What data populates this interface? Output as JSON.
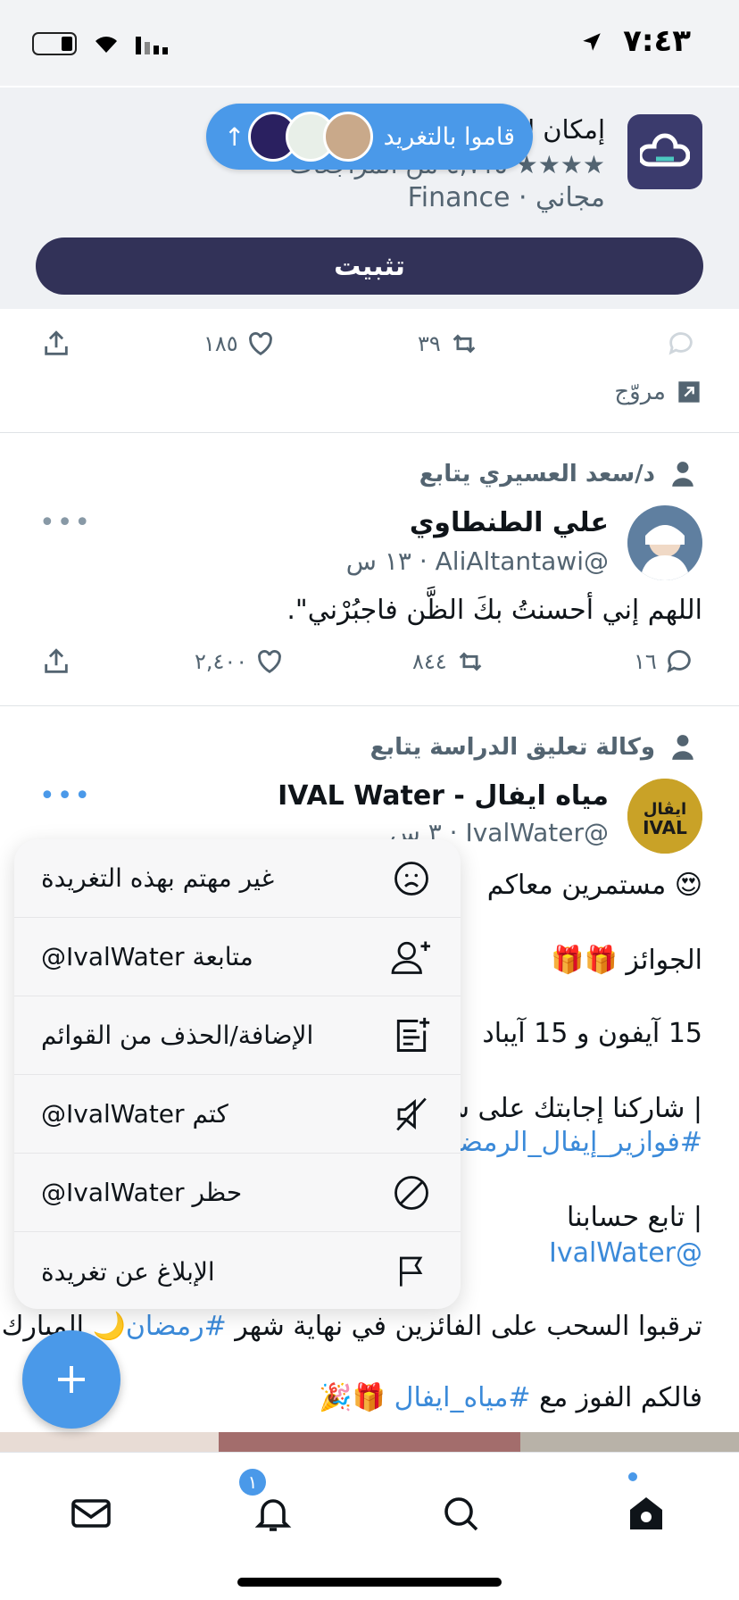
{
  "status_bar": {
    "time": "٧:٤٣"
  },
  "ad": {
    "title": "إمكان ل",
    "rating_text": "★★★★ ٤,٧١٥ من المراجعات",
    "category": "مجاني · Finance",
    "install_label": "تثبيت",
    "retweets": "٣٩",
    "likes": "١٨٥",
    "promoted_label": "مروّج"
  },
  "new_tweets_pill": {
    "label": "قاموا بالتغريد"
  },
  "tweets": [
    {
      "social_context": "د/سعد العسيري يتابع",
      "name": "علي الطنطاوي",
      "handle_time": "@AliAltantawi · ١٣ س",
      "text": "اللهم إني أحسنتُ بكَ الظَّن فاجبُرْني\".",
      "replies": "١٦",
      "retweets": "٨٤٤",
      "likes": "٢,٤٠٠"
    },
    {
      "social_context": "وكالة تعليق الدراسة يتابع",
      "name": "مياه ايفال - IVAL Water",
      "handle_time": "@IvalWater · ٣ س",
      "line1": "😍 مستمرين معاكم",
      "line2": "الجوائز 🎁🎁",
      "line3": "15 آيفون و 15 آيباد",
      "line4": "| شاركنا إجابتك على س",
      "line5": "#فوازير_إيفال_الرمضان",
      "line6": "| تابع حسابنا",
      "line7": "@IvalWater",
      "line8_pre": "ترقبوا السحب على الفائزين في نهاية شهر ",
      "line8_tag": "#رمضان",
      "line8_post": "🌙 المبارك",
      "line9_pre": "فالكم الفوز مع ",
      "line9_tag": "#مياه_ايفال",
      "line9_post": " 🎁🎉"
    }
  ],
  "menu": {
    "items": [
      {
        "label": "غير مهتم بهذه التغريدة",
        "icon": "sad-face-icon"
      },
      {
        "label": "متابعة IvalWater@",
        "icon": "follow-user-icon"
      },
      {
        "label": "الإضافة/الحذف من القوائم",
        "icon": "add-to-list-icon"
      },
      {
        "label": "كتم IvalWater@",
        "icon": "mute-icon"
      },
      {
        "label": "حظر IvalWater@",
        "icon": "block-icon"
      },
      {
        "label": "الإبلاغ عن تغريدة",
        "icon": "report-flag-icon"
      }
    ]
  },
  "tab_bar": {
    "notifications_badge": "١"
  },
  "colors": {
    "accent": "#4a99e9",
    "install": "#323258"
  }
}
